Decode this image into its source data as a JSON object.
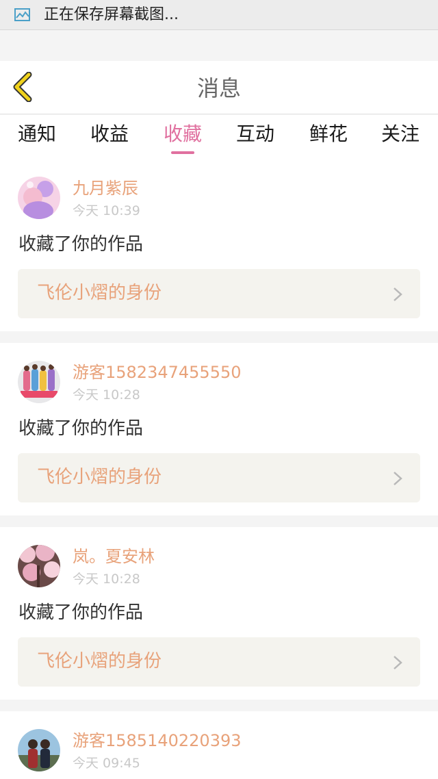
{
  "status_bar": {
    "text": "正在保存屏幕截图..."
  },
  "header": {
    "title": "消息"
  },
  "tabs": [
    {
      "label": "通知"
    },
    {
      "label": "收益"
    },
    {
      "label": "收藏"
    },
    {
      "label": "互动"
    },
    {
      "label": "鲜花"
    },
    {
      "label": "关注"
    }
  ],
  "active_tab": "收藏",
  "messages": [
    {
      "username": "九月紫辰",
      "time": "今天 10:39",
      "action": "收藏了你的作品",
      "work": "飞伦小熠的身份",
      "avatar": "anime-girl-avatar"
    },
    {
      "username": "游客1582347455550",
      "time": "今天 10:28",
      "action": "收藏了你的作品",
      "work": "飞伦小熠的身份",
      "avatar": "group-photo-avatar"
    },
    {
      "username": "岚。夏安林",
      "time": "今天 10:28",
      "action": "收藏了你的作品",
      "work": "飞伦小熠的身份",
      "avatar": "cherry-blossom-avatar"
    },
    {
      "username": "游客1585140220393",
      "time": "今天 09:45",
      "avatar": "couple-photo-avatar"
    }
  ],
  "colors": {
    "accent": "#e0709f",
    "username": "#e8a27a",
    "back_icon": "#f0d21c",
    "card_link_bg": "#f4f3ee"
  }
}
